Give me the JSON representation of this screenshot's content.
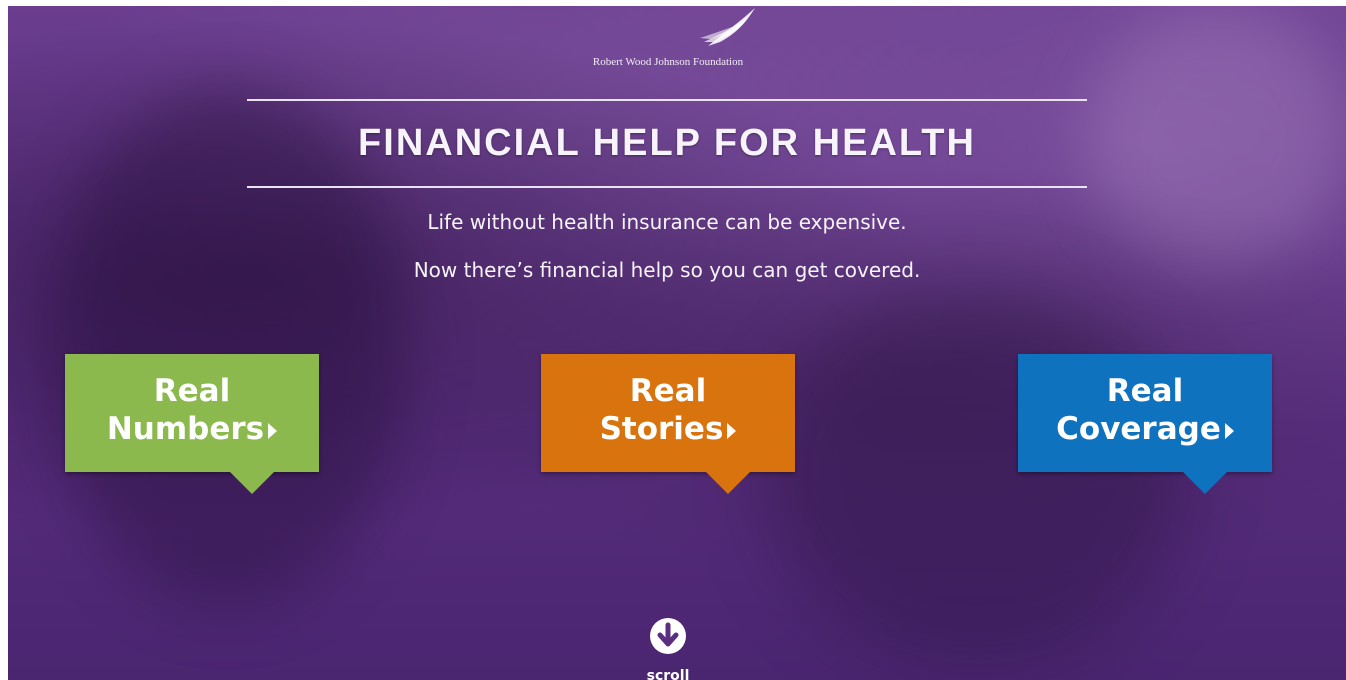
{
  "brand": {
    "logo_text": "Robert Wood Johnson Foundation"
  },
  "hero": {
    "headline": "FINANCIAL HELP FOR HEALTH",
    "subline_1": "Life without health insurance can be expensive.",
    "subline_2": "Now there’s financial help so you can get covered."
  },
  "cta_buttons": [
    {
      "line1": "Real",
      "line2": "Numbers",
      "color": "#8bb94e"
    },
    {
      "line1": "Real",
      "line2": "Stories",
      "color": "#d9730d"
    },
    {
      "line1": "Real",
      "line2": "Coverage",
      "color": "#0e72be"
    }
  ],
  "scroll": {
    "label": "scroll",
    "icon": "arrow-down-circle-icon"
  },
  "colors": {
    "overlay": "#5a2f80",
    "text": "#ffffff"
  }
}
